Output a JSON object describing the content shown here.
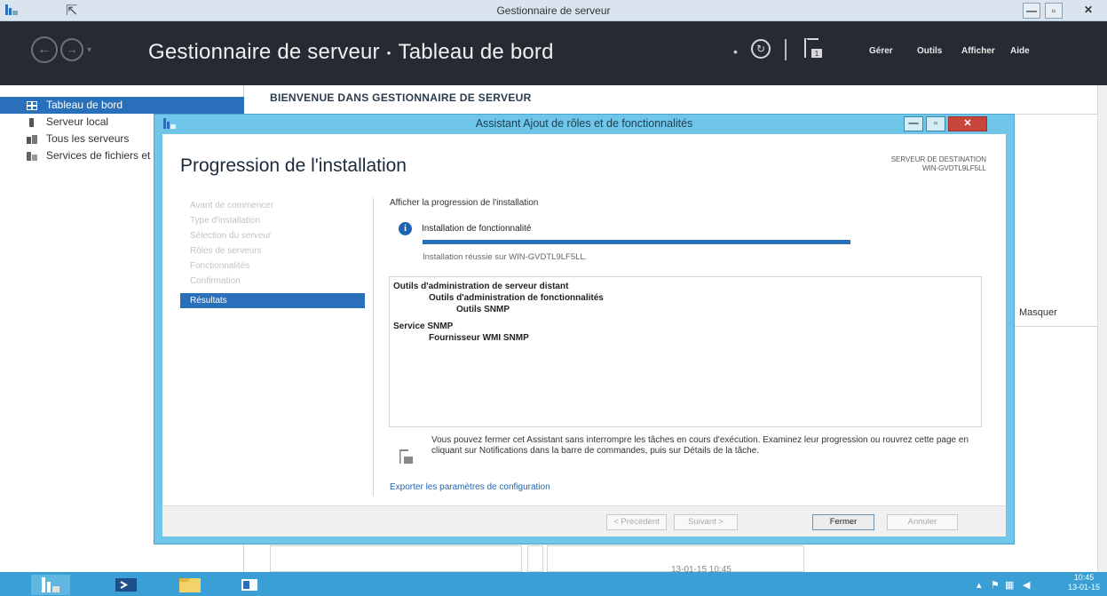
{
  "window": {
    "title": "Gestionnaire de serveur",
    "minimize": "—",
    "maximize": "▫",
    "close": "✕"
  },
  "header": {
    "breadcrumb_root": "Gestionnaire de serveur",
    "breadcrumb_sep": "•",
    "breadcrumb_page": "Tableau de bord",
    "menu": [
      "Gérer",
      "Outils",
      "Afficher",
      "Aide"
    ],
    "flag_count": "1"
  },
  "sidebar": {
    "items": [
      {
        "label": "Tableau de bord",
        "icon": "dashboard-icon",
        "active": true
      },
      {
        "label": "Serveur local",
        "icon": "server-icon",
        "active": false
      },
      {
        "label": "Tous les serveurs",
        "icon": "servers-icon",
        "active": false
      },
      {
        "label": "Services de fichiers et de stockage",
        "icon": "storage-icon",
        "active": false
      }
    ]
  },
  "main": {
    "welcome": "BIENVENUE DANS GESTIONNAIRE DE SERVEUR",
    "masquer": "Masquer",
    "date": "13-01-15 10:45"
  },
  "dialog": {
    "title": "Assistant Ajout de rôles et de fonctionnalités",
    "heading": "Progression de l'installation",
    "destination_label": "SERVEUR DE DESTINATION",
    "destination_server": "WIN-GVDTL9LF5LL",
    "steps": [
      {
        "label": "Avant de commencer",
        "active": false
      },
      {
        "label": "Type d'installation",
        "active": false
      },
      {
        "label": "Sélection du serveur",
        "active": false
      },
      {
        "label": "Rôles de serveurs",
        "active": false
      },
      {
        "label": "Fonctionnalités",
        "active": false
      },
      {
        "label": "Confirmation",
        "active": false
      },
      {
        "label": "Résultats",
        "active": true
      }
    ],
    "content_title": "Afficher la progression de l'installation",
    "feature_title": "Installation de fonctionnalité",
    "progress": 1.0,
    "success_text": "Installation réussie sur WIN-GVDTL9LF5LL.",
    "results": [
      {
        "text": "Outils d'administration de serveur distant",
        "level": 0
      },
      {
        "text": "Outils d'administration de fonctionnalités",
        "level": 1
      },
      {
        "text": "Outils SNMP",
        "level": 2
      },
      {
        "text": "Service SNMP",
        "level": 0
      },
      {
        "text": "Fournisseur WMI SNMP",
        "level": 1
      }
    ],
    "note": "Vous pouvez fermer cet Assistant sans interrompre les tâches en cours d'exécution. Examinez leur progression ou rouvrez cette page en cliquant sur Notifications dans la barre de commandes, puis sur Détails de la tâche.",
    "export_link": "Exporter les paramètres de configuration",
    "buttons": {
      "previous": "< Précédent",
      "next": "Suivant >",
      "close": "Fermer",
      "cancel": "Annuler"
    }
  },
  "taskbar": {
    "time": "10:45",
    "date": "13-01-15"
  },
  "colors": {
    "accent": "#2a6fb9",
    "header_bg": "#262b33",
    "dialog_frame": "#6fc6e8",
    "taskbar": "#3a9fd4"
  }
}
